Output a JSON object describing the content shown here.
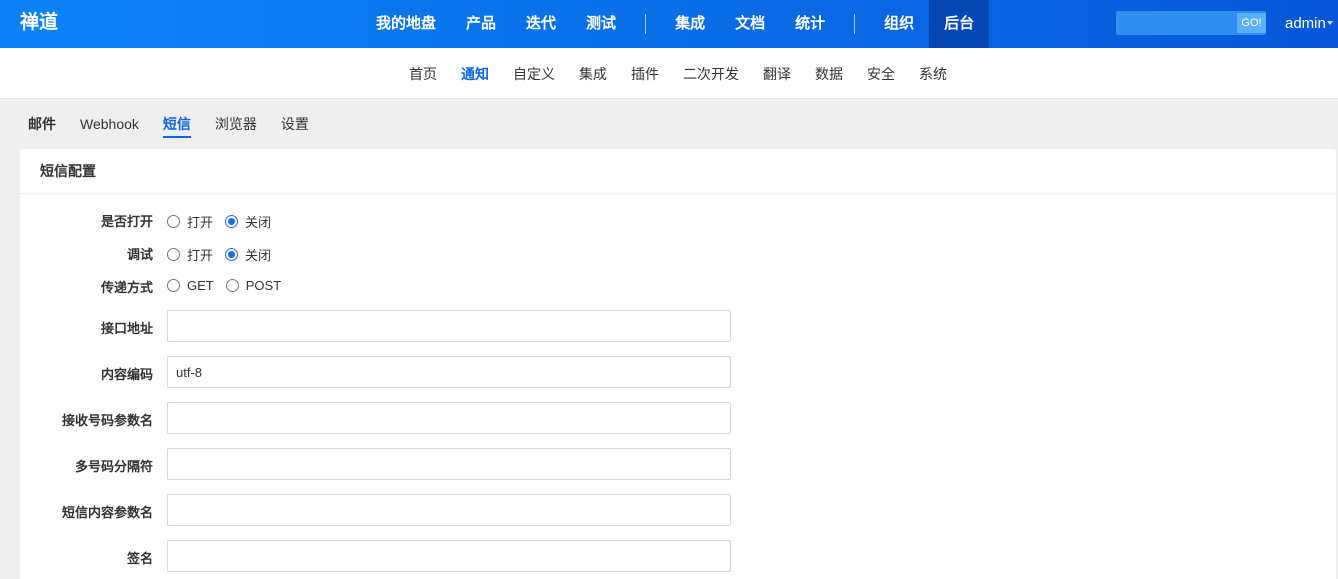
{
  "header": {
    "logo": "禅道",
    "nav": [
      {
        "label": "我的地盘"
      },
      {
        "label": "产品"
      },
      {
        "label": "迭代"
      },
      {
        "label": "测试"
      },
      {
        "label": "集成"
      },
      {
        "label": "文档"
      },
      {
        "label": "统计"
      },
      {
        "label": "组织"
      },
      {
        "label": "后台"
      }
    ],
    "active_nav": "后台",
    "search": {
      "value": "",
      "go_label": "GO!"
    },
    "user": "admin"
  },
  "subnav": {
    "items": [
      "首页",
      "通知",
      "自定义",
      "集成",
      "插件",
      "二次开发",
      "翻译",
      "数据",
      "安全",
      "系统"
    ],
    "active": "通知"
  },
  "tabs": {
    "items": [
      "邮件",
      "Webhook",
      "短信",
      "浏览器",
      "设置"
    ],
    "active": "短信"
  },
  "panel": {
    "title": "短信配置",
    "enable": {
      "label": "是否打开",
      "options": [
        "打开",
        "关闭"
      ],
      "selected": "关闭"
    },
    "debug": {
      "label": "调试",
      "options": [
        "打开",
        "关闭"
      ],
      "selected": "关闭"
    },
    "method": {
      "label": "传递方式",
      "options": [
        "GET",
        "POST"
      ],
      "selected": ""
    },
    "fields": {
      "api_url": {
        "label": "接口地址",
        "value": ""
      },
      "encoding": {
        "label": "内容编码",
        "value": "utf-8"
      },
      "receiver_param": {
        "label": "接收号码参数名",
        "value": ""
      },
      "separator": {
        "label": "多号码分隔符",
        "value": ""
      },
      "content_param": {
        "label": "短信内容参数名",
        "value": ""
      },
      "signature": {
        "label": "签名",
        "value": ""
      }
    }
  },
  "colors": {
    "header_start": "#0c83f5",
    "header_end": "#0757d8",
    "accent": "#0c64eb",
    "active_nav_bg": "#0548b5"
  }
}
